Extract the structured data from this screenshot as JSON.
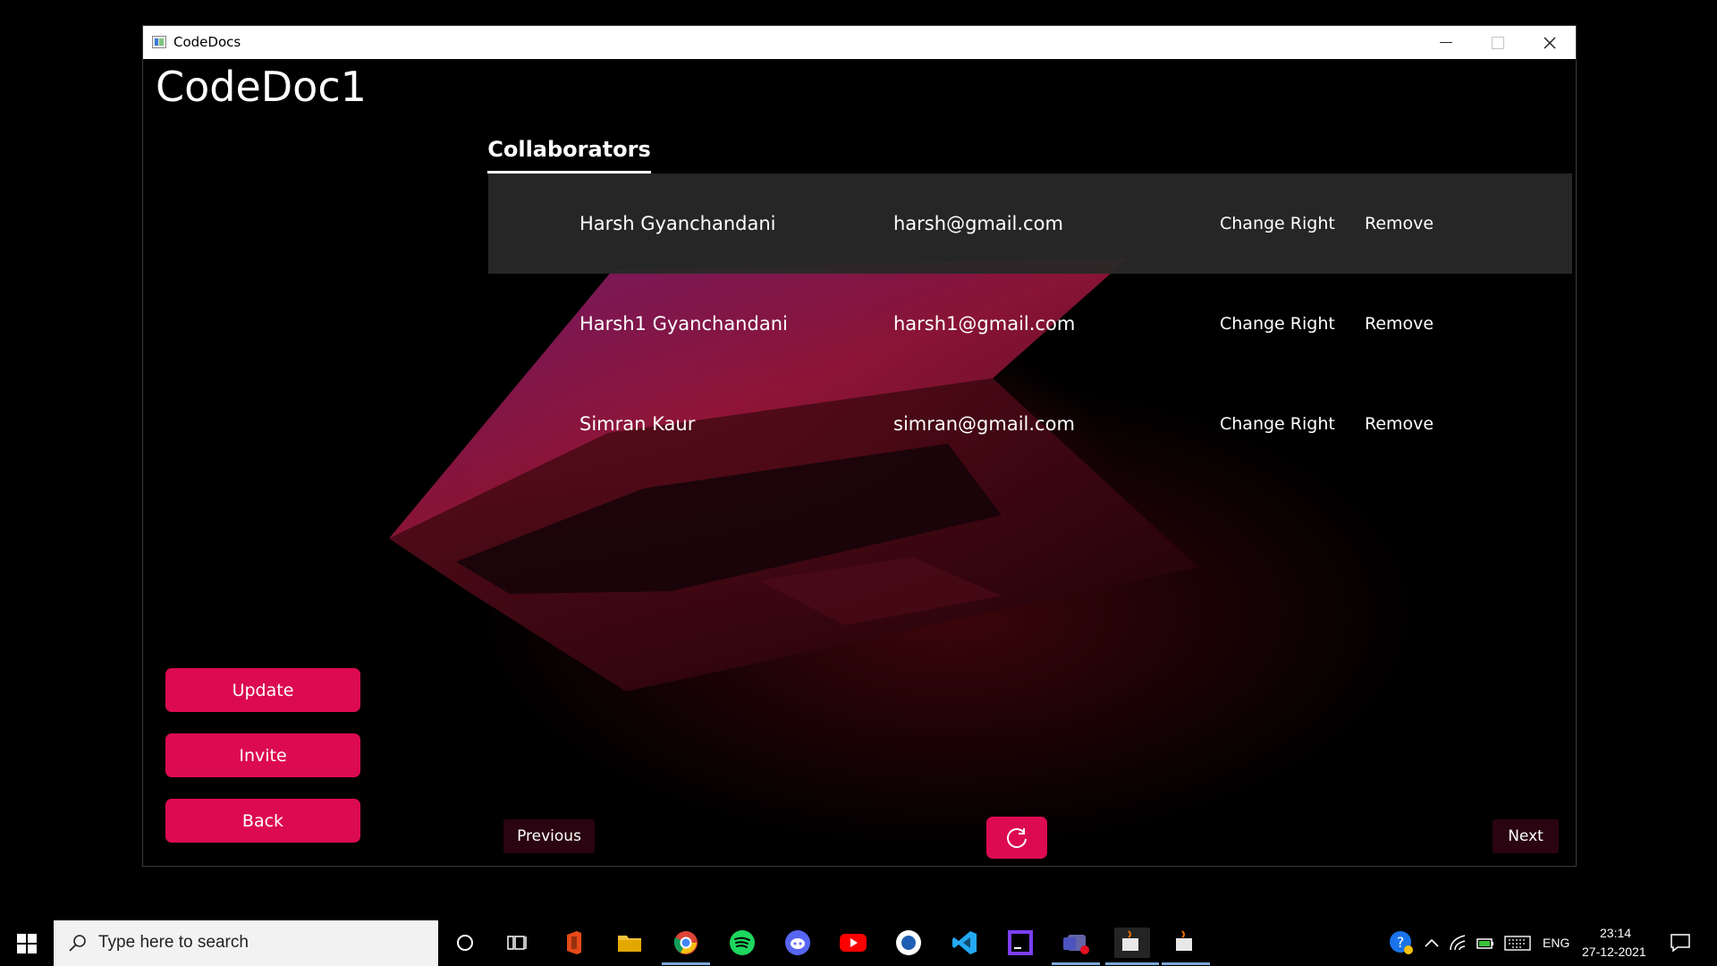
{
  "window": {
    "title": "CodeDocs"
  },
  "document": {
    "title": "CodeDoc1"
  },
  "tabs": {
    "collaborators": "Collaborators"
  },
  "collaborators": [
    {
      "name": "Harsh Gyanchandani",
      "email": "harsh@gmail.com",
      "change_label": "Change Right",
      "remove_label": "Remove",
      "selected": true
    },
    {
      "name": "Harsh1 Gyanchandani",
      "email": "harsh1@gmail.com",
      "change_label": "Change Right",
      "remove_label": "Remove",
      "selected": false
    },
    {
      "name": "Simran Kaur",
      "email": "simran@gmail.com",
      "change_label": "Change Right",
      "remove_label": "Remove",
      "selected": false
    }
  ],
  "sidebar": {
    "update": "Update",
    "invite": "Invite",
    "back": "Back"
  },
  "pager": {
    "previous": "Previous",
    "next": "Next",
    "refresh_icon": "refresh-icon"
  },
  "taskbar": {
    "search_placeholder": "Type here to search",
    "language": "ENG",
    "time": "23:14",
    "date": "27-12-2021"
  },
  "colors": {
    "accent": "#dc0a50",
    "nav_button": "#2a0410",
    "selected_row": "#282828"
  }
}
